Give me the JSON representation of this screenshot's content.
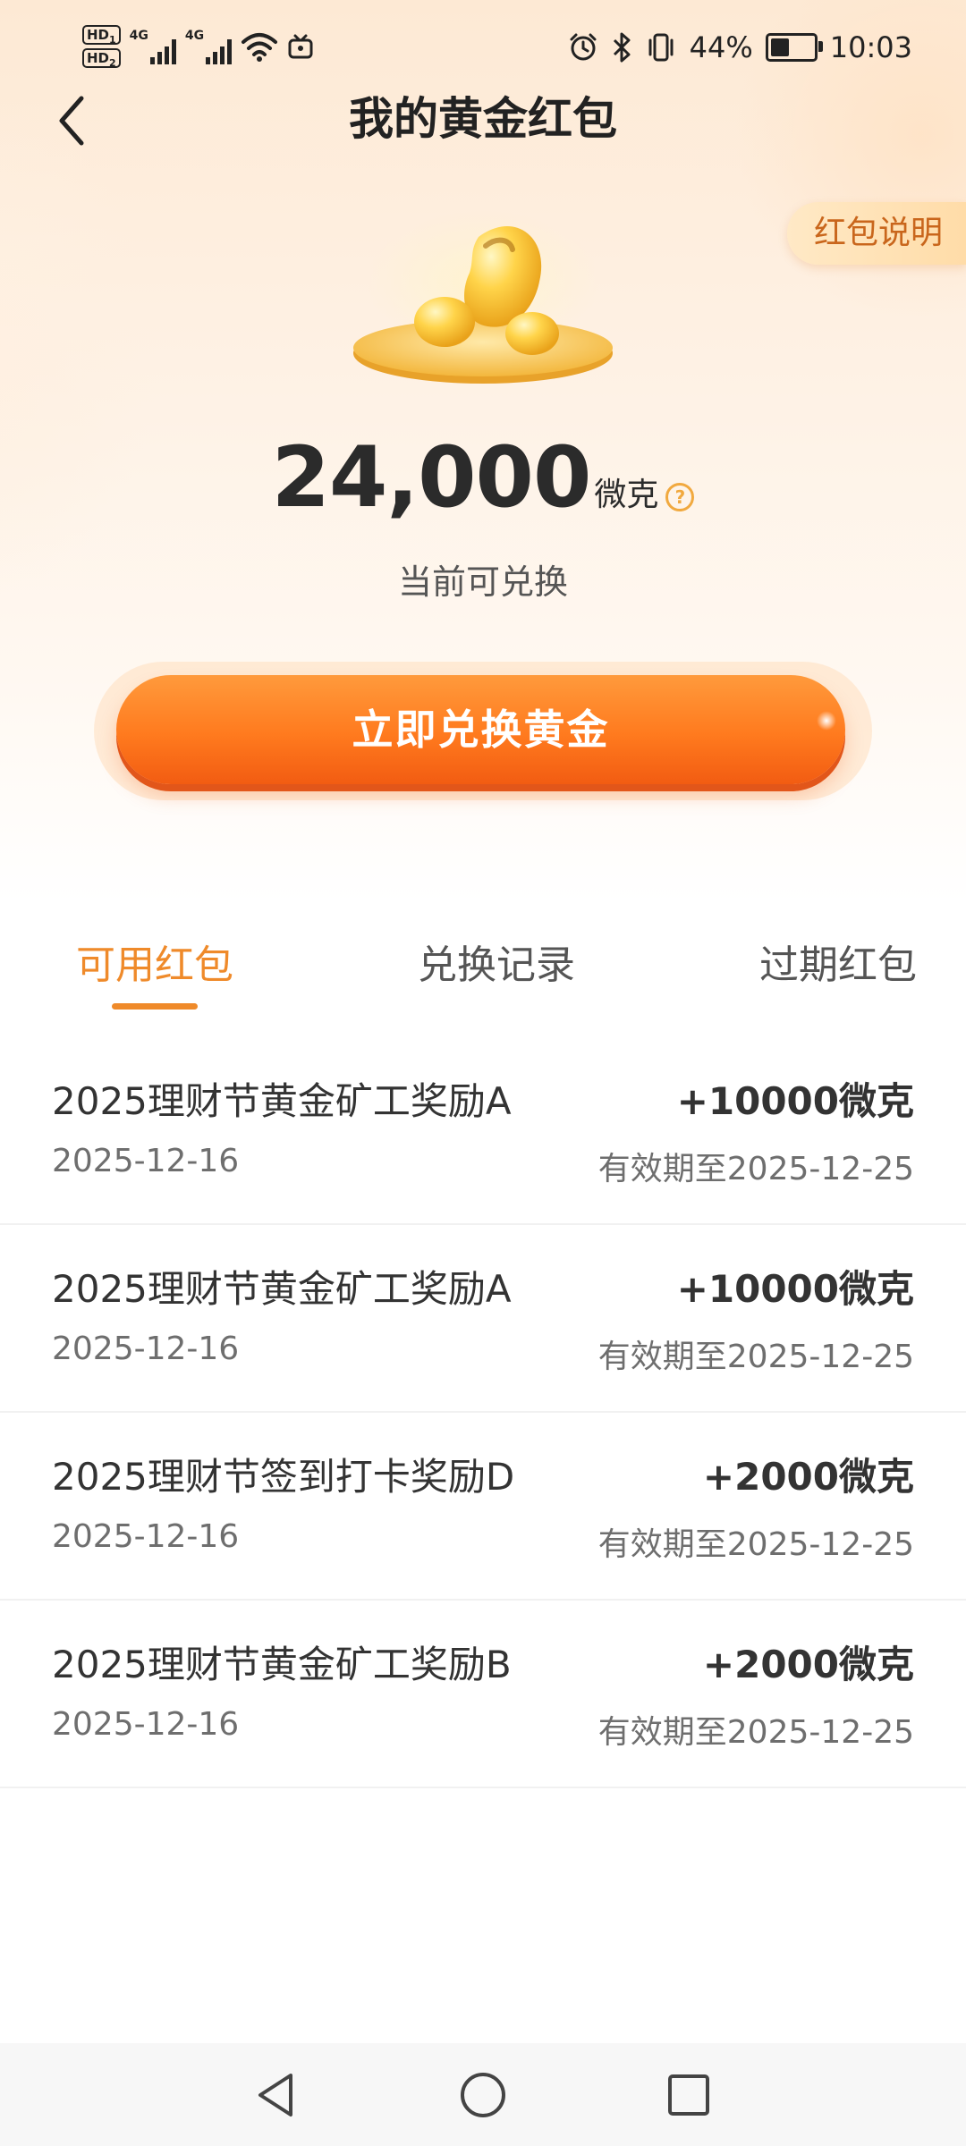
{
  "status_bar": {
    "sim1": "HD",
    "sim2": "HD",
    "net1": "4G",
    "net2": "4G",
    "battery_percent": "44%",
    "time": "10:03"
  },
  "header": {
    "title": "我的黄金红包",
    "rules_label": "红包说明"
  },
  "balance": {
    "amount": "24,000",
    "unit": "微克",
    "caption": "当前可兑换"
  },
  "cta": {
    "label": "立即兑换黄金"
  },
  "tabs": [
    {
      "label": "可用红包",
      "active": true
    },
    {
      "label": "兑换记录",
      "active": false
    },
    {
      "label": "过期红包",
      "active": false
    }
  ],
  "items": [
    {
      "title": "2025理财节黄金矿工奖励A",
      "amount": "+10000微克",
      "date": "2025-12-16",
      "expiry": "有效期至2025-12-25"
    },
    {
      "title": "2025理财节黄金矿工奖励A",
      "amount": "+10000微克",
      "date": "2025-12-16",
      "expiry": "有效期至2025-12-25"
    },
    {
      "title": "2025理财节签到打卡奖励D",
      "amount": "+2000微克",
      "date": "2025-12-16",
      "expiry": "有效期至2025-12-25"
    },
    {
      "title": "2025理财节黄金矿工奖励B",
      "amount": "+2000微克",
      "date": "2025-12-16",
      "expiry": "有效期至2025-12-25"
    }
  ],
  "colors": {
    "accent": "#ef8a2a",
    "cta_start": "#ff9a3c",
    "cta_end": "#f25c12",
    "hero_bg": "#fde9d4"
  },
  "icons": {
    "back": "chevron-left-icon",
    "help": "question-circle-icon",
    "gold": "gold-nugget-icon",
    "sys_back": "triangle-back-icon",
    "sys_home": "circle-home-icon",
    "sys_recents": "square-recents-icon"
  }
}
